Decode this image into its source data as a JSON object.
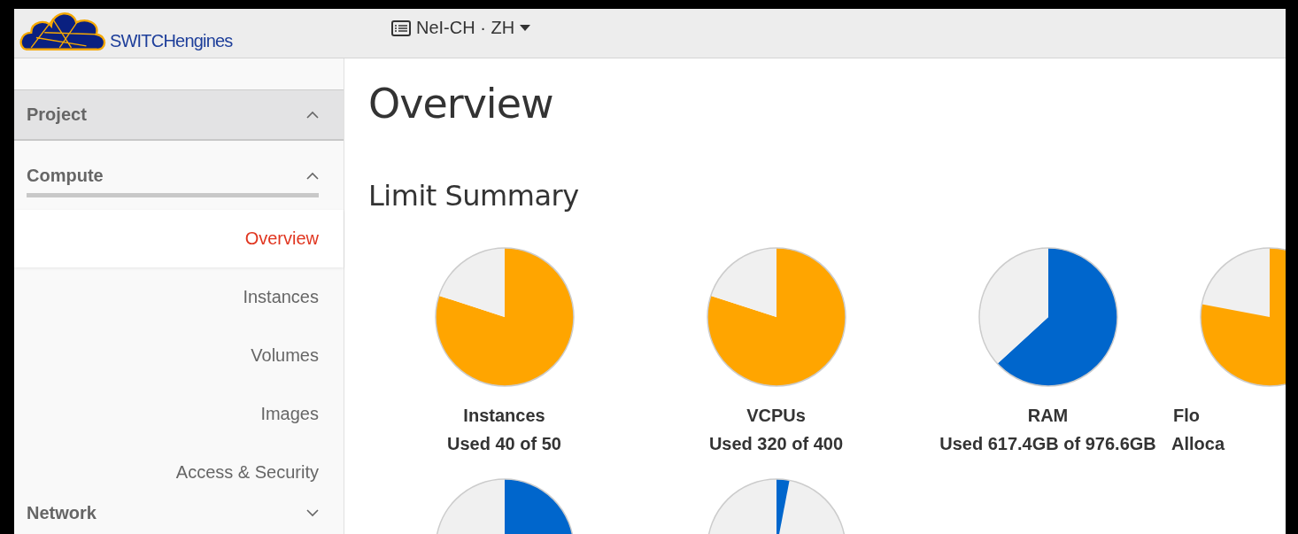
{
  "header": {
    "logo_text": "SWITCHengines",
    "project_menu": "NeI-CH · ZH"
  },
  "sidebar": {
    "sections": [
      {
        "label": "Project",
        "expanded": true,
        "children": [
          {
            "label": "Compute",
            "expanded": true,
            "children": [
              {
                "label": "Overview",
                "selected": true
              },
              {
                "label": "Instances",
                "selected": false
              },
              {
                "label": "Volumes",
                "selected": false
              },
              {
                "label": "Images",
                "selected": false
              },
              {
                "label": "Access & Security",
                "selected": false
              }
            ]
          },
          {
            "label": "Network",
            "expanded": false
          }
        ]
      }
    ]
  },
  "page": {
    "title": "Overview",
    "section_title": "Limit Summary"
  },
  "limits": [
    {
      "kind": "full",
      "name": "Instances",
      "usage": "Used 40 of 50",
      "color": "#ffa500",
      "chart_data": {
        "type": "pie",
        "values": [
          80,
          20
        ]
      }
    },
    {
      "kind": "full",
      "name": "VCPUs",
      "usage": "Used 320 of 400",
      "color": "#ffa500",
      "chart_data": {
        "type": "pie",
        "values": [
          80,
          20
        ]
      }
    },
    {
      "kind": "full",
      "name": "RAM",
      "usage": "Used 617.4GB of 976.6GB",
      "color": "#0066cc",
      "chart_data": {
        "type": "pie",
        "values": [
          63.2,
          36.8
        ]
      }
    },
    {
      "kind": "cut",
      "name": "Flo",
      "usage": "Alloca",
      "color": "#ffa500"
    },
    {
      "kind": "picture",
      "color": "#0066cc"
    },
    {
      "kind": "picture",
      "color": "#0066cc"
    }
  ]
}
